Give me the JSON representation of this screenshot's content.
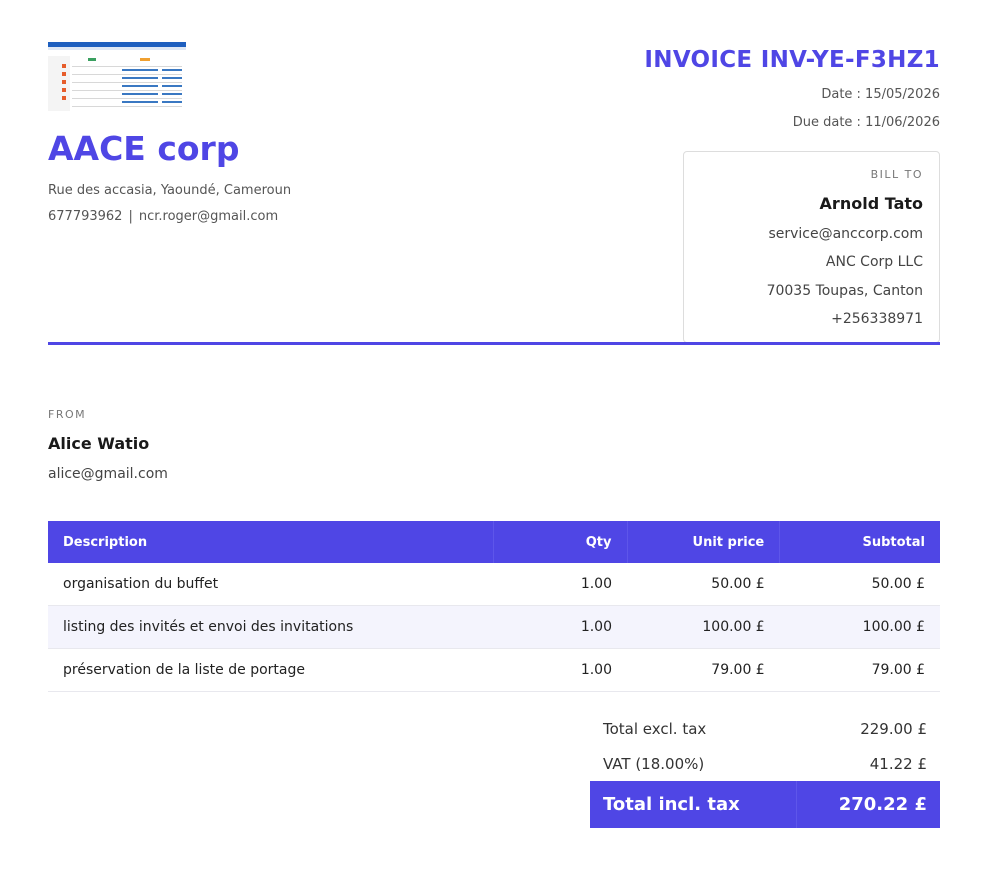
{
  "company": {
    "name": "AACE corp",
    "address": "Rue des accasia, Yaoundé, Cameroun",
    "phone": "677793962",
    "separator": "|",
    "email": "ncr.roger@gmail.com"
  },
  "invoice": {
    "title": "INVOICE INV-YE-F3HZ1",
    "date": "Date : 15/05/2026",
    "due_date": "Due date : 11/06/2026"
  },
  "bill_to": {
    "label": "BILL TO",
    "name": "Arnold Tato",
    "email": "service@anccorp.com",
    "company": "ANC Corp LLC",
    "address": "70035 Toupas, Canton",
    "phone": "+256338971"
  },
  "from": {
    "label": "FROM",
    "name": "Alice Watio",
    "email": "alice@gmail.com"
  },
  "table": {
    "headers": {
      "description": "Description",
      "qty": "Qty",
      "unit_price": "Unit price",
      "subtotal": "Subtotal"
    },
    "rows": [
      {
        "description": "organisation du buffet",
        "qty": "1.00",
        "unit_price": "50.00 £",
        "subtotal": "50.00 £"
      },
      {
        "description": "listing des invités et envoi des invitations",
        "qty": "1.00",
        "unit_price": "100.00 £",
        "subtotal": "100.00 £"
      },
      {
        "description": "préservation de la liste de portage",
        "qty": "1.00",
        "unit_price": "79.00 £",
        "subtotal": "79.00 £"
      }
    ]
  },
  "totals": {
    "excl_label": "Total excl. tax",
    "excl_value": "229.00 £",
    "vat_label": "VAT (18.00%)",
    "vat_value": "41.22 £",
    "incl_label": "Total incl. tax",
    "incl_value": "270.22 £"
  },
  "colors": {
    "accent": "#4f46e5",
    "row_alt": "#f4f4fd"
  }
}
